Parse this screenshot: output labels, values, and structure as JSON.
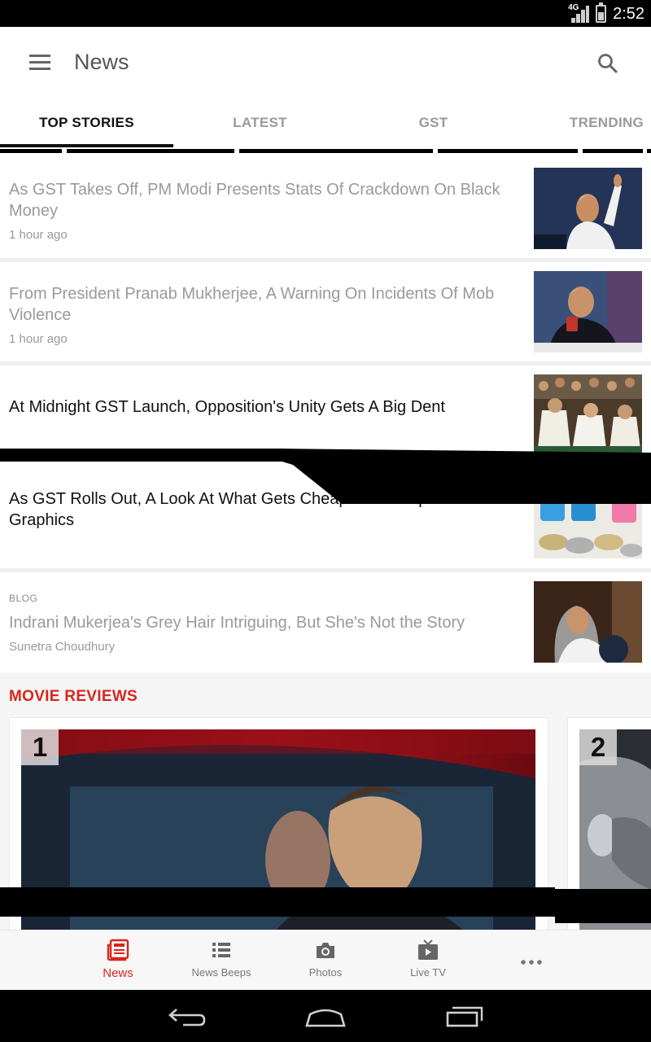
{
  "status_bar": {
    "network": "4G",
    "time": "2:52"
  },
  "app_bar": {
    "title": "News"
  },
  "tabs": [
    {
      "label": "TOP STORIES",
      "active": true
    },
    {
      "label": "LATEST",
      "active": false
    },
    {
      "label": "GST",
      "active": false
    },
    {
      "label": "TRENDING",
      "active": false
    }
  ],
  "stories": [
    {
      "title": "As GST Takes Off, PM Modi Presents Stats Of Crackdown On Black Money",
      "meta": "1 hour ago",
      "read": true
    },
    {
      "title": "From President Pranab Mukherjee, A Warning On Incidents Of Mob Violence",
      "meta": "1 hour ago",
      "read": true
    },
    {
      "title": "At Midnight GST Launch, Opposition's Unity Gets A Big Dent",
      "meta": "",
      "read": false
    },
    {
      "title": "As GST Rolls Out, A Look At What Gets Cheaper And Expensive In Graphics",
      "meta": "",
      "read": false
    },
    {
      "kicker": "BLOG",
      "title": "Indrani Mukerjea's Grey Hair Intriguing, But She's Not the Story",
      "meta": "Sunetra Choudhury",
      "read": true
    }
  ],
  "movie_reviews": {
    "title": "MOVIE REVIEWS",
    "cards": [
      {
        "rank": "1"
      },
      {
        "rank": "2"
      }
    ]
  },
  "bottom_nav": [
    {
      "label": "News",
      "icon": "newspaper-icon",
      "active": true
    },
    {
      "label": "News Beeps",
      "icon": "list-icon",
      "active": false
    },
    {
      "label": "Photos",
      "icon": "camera-icon",
      "active": false
    },
    {
      "label": "Live TV",
      "icon": "tv-icon",
      "active": false
    }
  ],
  "colors": {
    "accent": "#d7261f",
    "read_text": "#9a9a9a",
    "unread_text": "#111111"
  }
}
